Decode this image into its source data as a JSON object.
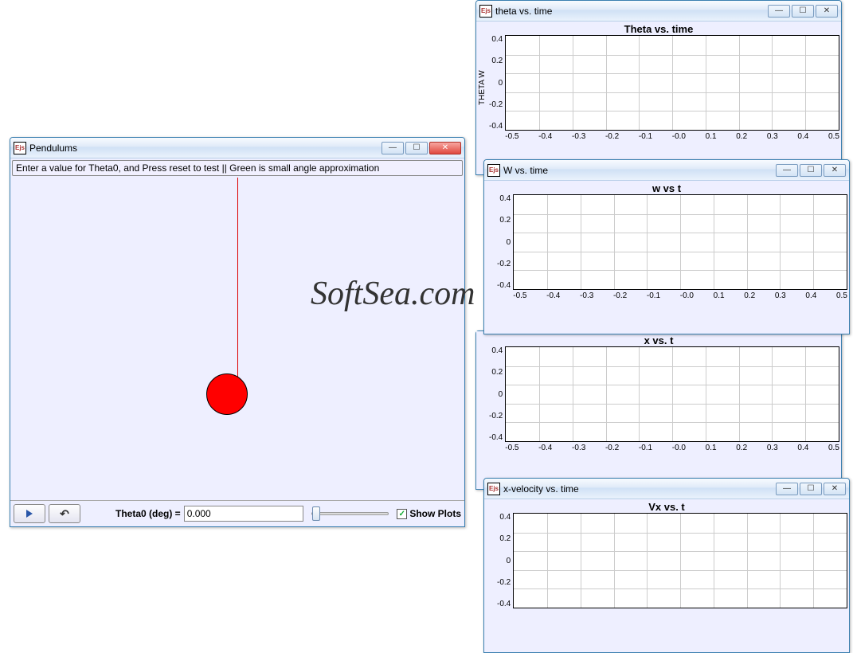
{
  "watermark": "SoftSea.com",
  "main_window": {
    "title": "Pendulums",
    "instruction": "Enter a value for Theta0, and Press reset to test || Green is small angle approximation",
    "theta_label": "Theta0 (deg) =",
    "theta_value": "0.000",
    "show_plots_label": "Show Plots",
    "show_plots_checked": "✓"
  },
  "plots": {
    "theta": {
      "window_title": "theta vs. time",
      "chart_title": "Theta vs. time",
      "y_label": "THETA W"
    },
    "w": {
      "window_title": "W vs. time",
      "chart_title": "w vs t"
    },
    "x": {
      "window_title": "x vs. t",
      "chart_title": "x vs. t"
    },
    "vx": {
      "window_title": "x-velocity vs. time",
      "chart_title": "Vx vs. t"
    }
  },
  "chart_data": [
    {
      "type": "line",
      "title": "Theta vs. time",
      "ylabel": "THETA W",
      "xlabel": "",
      "xlim": [
        -0.5,
        0.5
      ],
      "ylim": [
        -0.5,
        0.5
      ],
      "x_ticks": [
        "-0.5",
        "-0.4",
        "-0.3",
        "-0.2",
        "-0.1",
        "-0.0",
        "0.1",
        "0.2",
        "0.3",
        "0.4",
        "0.5"
      ],
      "y_ticks": [
        "0.4",
        "0.2",
        "0",
        "-0.2",
        "-0.4"
      ],
      "series": []
    },
    {
      "type": "line",
      "title": "w vs t",
      "xlim": [
        -0.5,
        0.5
      ],
      "ylim": [
        -0.5,
        0.5
      ],
      "x_ticks": [
        "-0.5",
        "-0.4",
        "-0.3",
        "-0.2",
        "-0.1",
        "-0.0",
        "0.1",
        "0.2",
        "0.3",
        "0.4",
        "0.5"
      ],
      "y_ticks": [
        "0.4",
        "0.2",
        "0",
        "-0.2",
        "-0.4"
      ],
      "series": []
    },
    {
      "type": "line",
      "title": "x vs. t",
      "xlim": [
        -0.5,
        0.5
      ],
      "ylim": [
        -0.5,
        0.5
      ],
      "x_ticks": [
        "-0.5",
        "-0.4",
        "-0.3",
        "-0.2",
        "-0.1",
        "-0.0",
        "0.1",
        "0.2",
        "0.3",
        "0.4",
        "0.5"
      ],
      "y_ticks": [
        "0.4",
        "0.2",
        "0",
        "-0.2",
        "-0.4"
      ],
      "series": []
    },
    {
      "type": "line",
      "title": "Vx vs. t",
      "xlim": [
        -0.5,
        0.5
      ],
      "ylim": [
        -0.5,
        0.5
      ],
      "x_ticks": [
        "-0.5",
        "-0.4",
        "-0.3",
        "-0.2",
        "-0.1",
        "-0.0",
        "0.1",
        "0.2",
        "0.3",
        "0.4",
        "0.5"
      ],
      "y_ticks": [
        "0.4",
        "0.2",
        "0",
        "-0.2",
        "-0.4"
      ],
      "series": []
    }
  ]
}
